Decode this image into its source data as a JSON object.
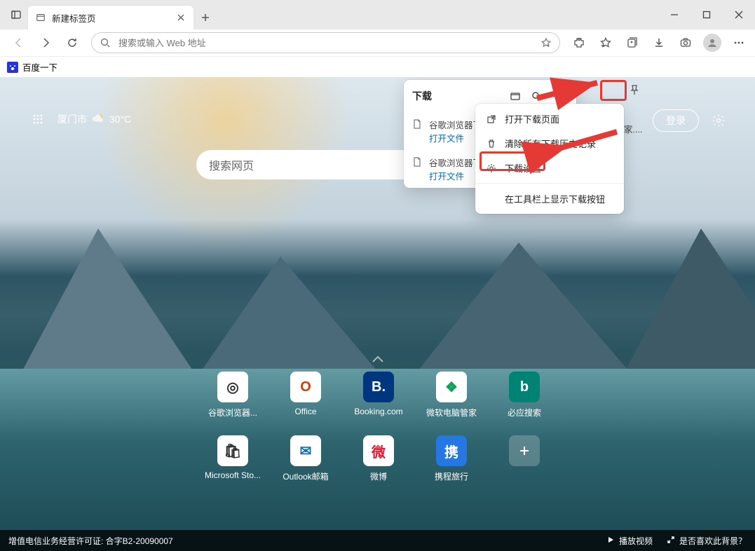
{
  "window": {
    "tab_title": "新建标签页"
  },
  "toolbar": {
    "url_placeholder": "搜索或输入 Web 地址"
  },
  "bookmarks_bar": {
    "items": [
      {
        "label": "百度一下"
      }
    ]
  },
  "ntp": {
    "location": "厦门市",
    "temperature": "30°C",
    "login_label": "登录",
    "search_placeholder": "搜索网页",
    "tiles": [
      {
        "label": "谷歌浏览器...",
        "bg": "#ffffff",
        "fg": "#333",
        "glyph": "◎"
      },
      {
        "label": "Office",
        "bg": "#ffffff",
        "fg": "#d83b01",
        "glyph": "O"
      },
      {
        "label": "Booking.com",
        "bg": "#003580",
        "fg": "#fff",
        "glyph": "B."
      },
      {
        "label": "微软电脑管家",
        "bg": "#ffffff",
        "fg": "#0e9f57",
        "glyph": "❖"
      },
      {
        "label": "必应搜索",
        "bg": "#008373",
        "fg": "#fff",
        "glyph": "b"
      },
      {
        "label": "Microsoft Sto...",
        "bg": "#ffffff",
        "fg": "#333",
        "glyph": "🛍"
      },
      {
        "label": "Outlook邮箱",
        "bg": "#ffffff",
        "fg": "#0f6cbd",
        "glyph": "✉"
      },
      {
        "label": "微博",
        "bg": "#ffffff",
        "fg": "#e6162d",
        "glyph": "微"
      },
      {
        "label": "携程旅行",
        "bg": "#2577e3",
        "fg": "#fff",
        "glyph": "携"
      }
    ]
  },
  "footer": {
    "license": "增值电信业务经营许可证: 合字B2-20090007",
    "play_video": "播放视频",
    "like_bg": "是否喜欢此背景？"
  },
  "downloads": {
    "title": "下载",
    "items": [
      {
        "name": "谷歌浏览器下",
        "action": "打开文件"
      },
      {
        "name": "谷歌浏览器下",
        "action": "打开文件"
      }
    ]
  },
  "submenu": {
    "open_page": "打开下载页面",
    "clear_history": "清除所有下载历史记录",
    "download_settings": "下载设置",
    "show_on_toolbar": "在工具栏上显示下载按钮"
  },
  "ghost_text": "家...."
}
